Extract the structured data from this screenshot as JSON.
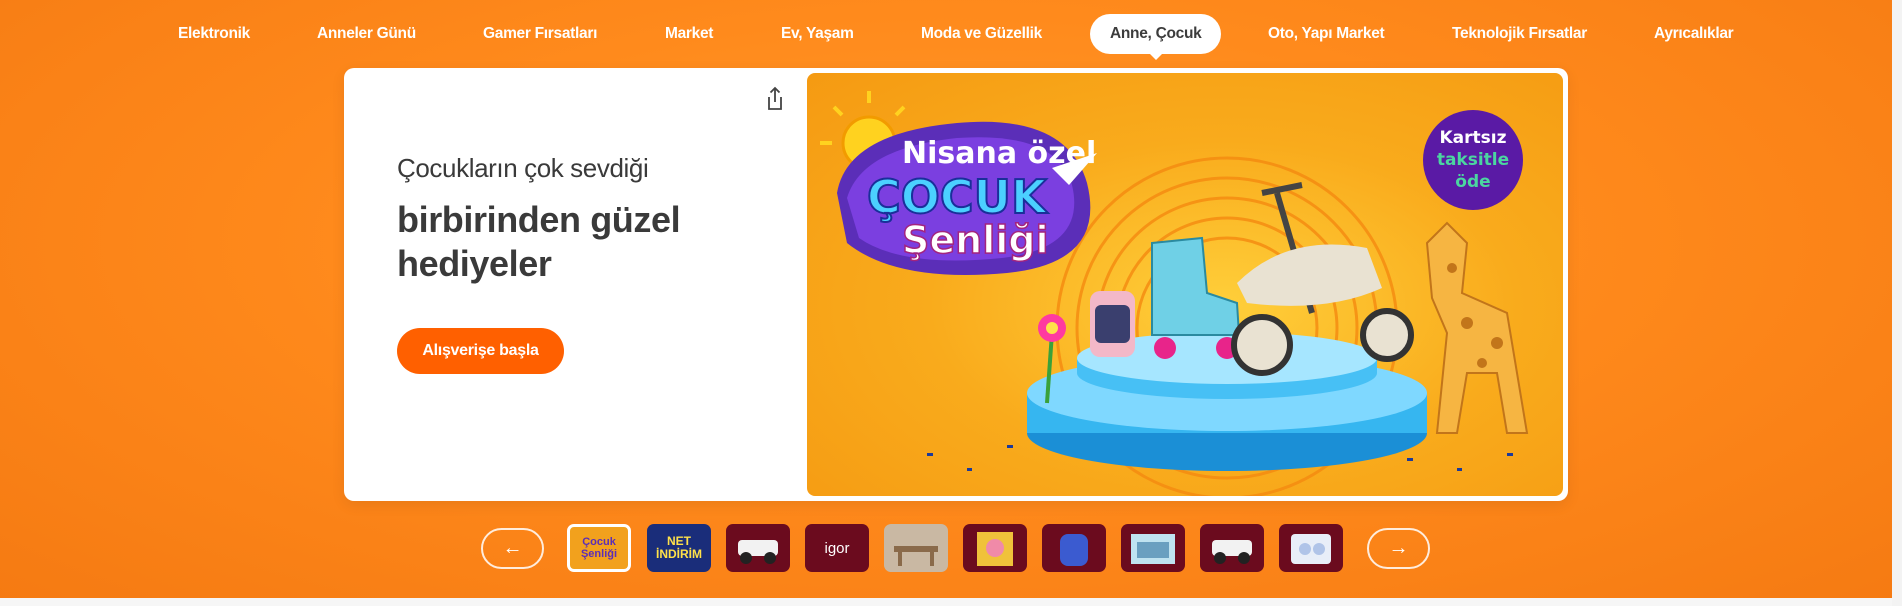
{
  "nav": {
    "items": [
      {
        "label": "Elektronik"
      },
      {
        "label": "Anneler Günü"
      },
      {
        "label": "Gamer Fırsatları"
      },
      {
        "label": "Market"
      },
      {
        "label": "Ev, Yaşam"
      },
      {
        "label": "Moda ve Güzellik"
      },
      {
        "label": "Anne, Çocuk"
      },
      {
        "label": "Oto, Yapı Market"
      },
      {
        "label": "Teknolojik Fırsatlar"
      },
      {
        "label": "Ayrıcalıklar"
      }
    ],
    "active_index": 6
  },
  "hero": {
    "subtitle": "Çocukların çok sevdiği",
    "headline_line1": "birbirinden güzel",
    "headline_line2": "hediyeler",
    "cta_label": "Alışverişe başla",
    "banner": {
      "line1": "Nisana özel",
      "line2": "ÇOCUK",
      "line3": "Şenliği",
      "badge_line1": "Kartsız",
      "badge_line2": "taksitle",
      "badge_line3": "öde"
    }
  },
  "thumbnails": {
    "prev_icon": "arrow-left-icon",
    "next_icon": "arrow-right-icon",
    "items": [
      {
        "label": "Çocuk Şenliği",
        "bg": "#f2a11d",
        "active": true
      },
      {
        "label": "NET İNDİRİM",
        "bg": "#1a2d7a"
      },
      {
        "label": "",
        "bg": "#6b0b1e"
      },
      {
        "label": "igor",
        "bg": "#6b0b1e"
      },
      {
        "label": "",
        "bg": "#c9b8a3"
      },
      {
        "label": "",
        "bg": "#6b0b1e"
      },
      {
        "label": "",
        "bg": "#6b0b1e"
      },
      {
        "label": "",
        "bg": "#6b0b1e"
      },
      {
        "label": "",
        "bg": "#6b0b1e"
      },
      {
        "label": "",
        "bg": "#6b0b1e"
      }
    ]
  },
  "colors": {
    "accent": "#ff6000",
    "background": "#ff8a1c"
  }
}
